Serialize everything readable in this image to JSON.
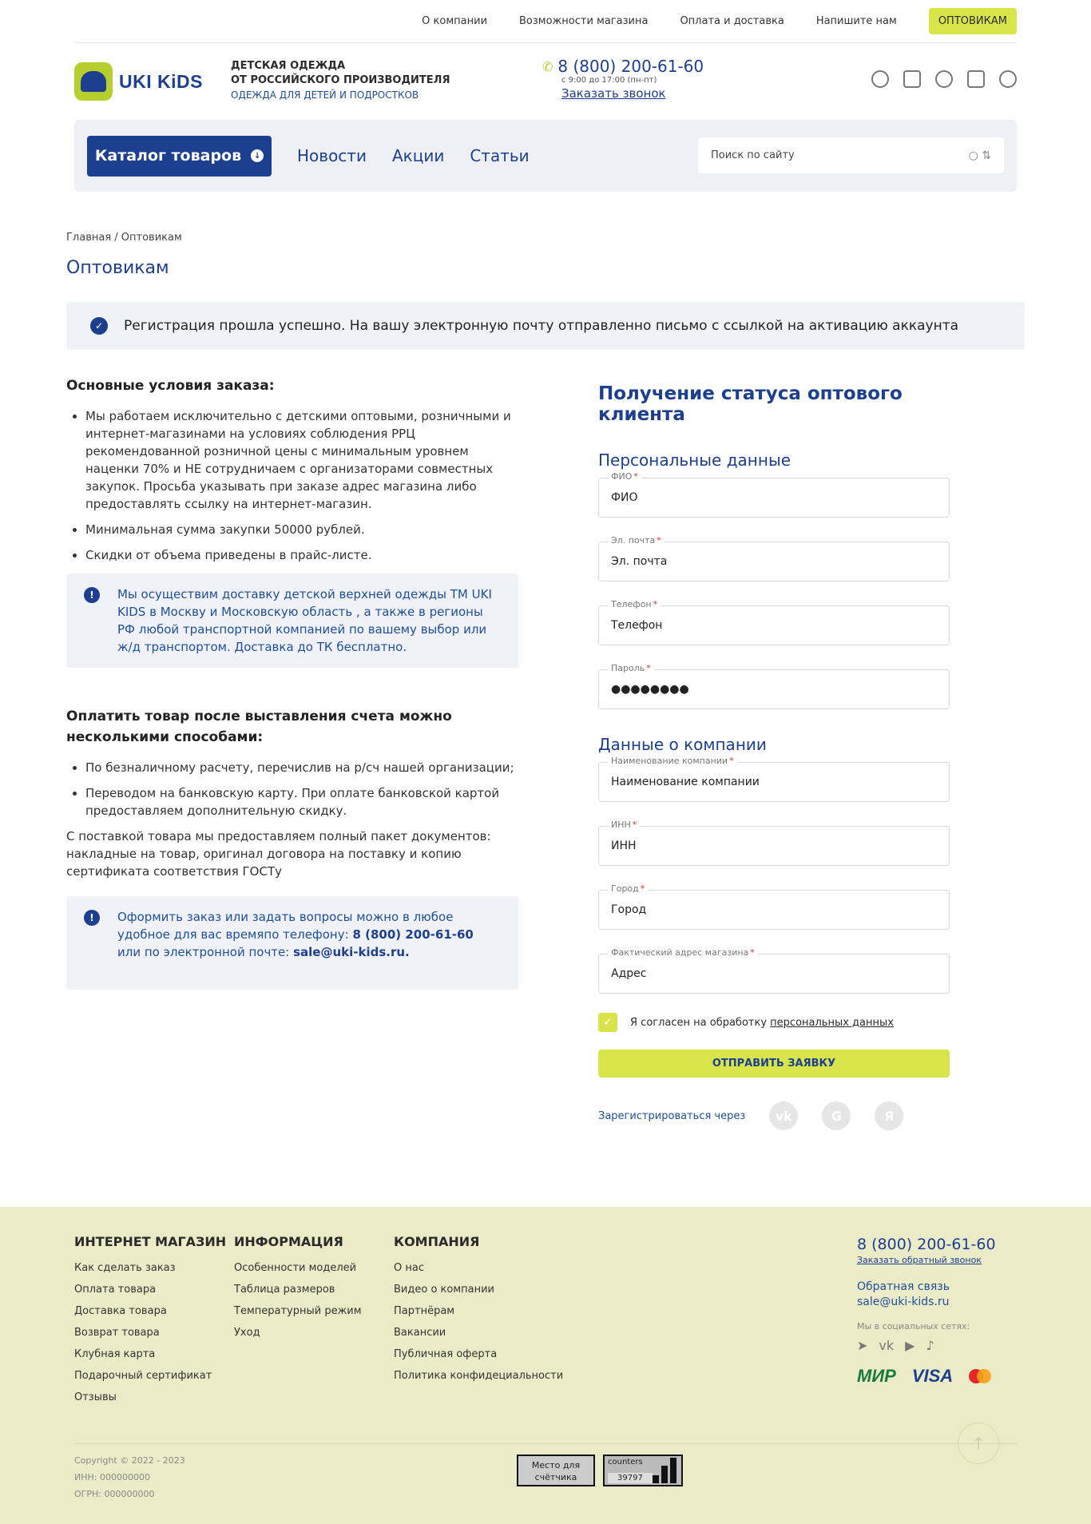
{
  "topnav": [
    "О компании",
    "Возможности магазина",
    "Оплата и доставка",
    "Напишите нам",
    "ОПТОВИКАМ"
  ],
  "logo": "UKI KiDS",
  "tagline": {
    "line1": "ДЕТСКАЯ ОДЕЖДА",
    "line2": "ОТ РОССИЙСКОГО ПРОИЗВОДИТЕЛЯ",
    "line3": "ОДЕЖДА ДЛЯ ДЕТЕЙ И ПОДРОСТКОВ"
  },
  "phone": {
    "number": "8 (800) 200-61-60",
    "hours": "с 9:00 до 17:00 (пн-пт)",
    "callback": "Заказать звонок"
  },
  "header_icons": [
    "location-icon",
    "delivery-icon",
    "heart-icon",
    "basket-icon",
    "user-icon"
  ],
  "nav": {
    "catalog": "Каталог товаров",
    "links": [
      "Новости",
      "Акции",
      "Статьи"
    ],
    "search_placeholder": "Поиск по сайту"
  },
  "breadcrumb": "Главная / Оптовикам",
  "title": "Оптовикам",
  "success": "Регистрация прошла успешно. На вашу электронную почту отправленно письмо с ссылкой на активацию аккаунта",
  "left": {
    "conditions_title": "Основные условия заказа:",
    "conditions": [
      "Мы работаем исключительно с детскими оптовыми, розничными и интернет-магазинами на условиях соблюдения РРЦ рекомендованной розничной цены с минимальным уровнем наценки 70% и НЕ сотрудничаем с организаторами совместных закупок. Просьба указывать при заказе адрес магазина либо предоставлять ссылку на интернет-магазин.",
      "Минимальная сумма закупки 50000 рублей.",
      "Скидки от объема приведены в прайс-листе."
    ],
    "delivery_note": "Мы осуществим доставку детской верхней одежды ТМ UKI KIDS в Москву и Московскую область , а также в регионы РФ любой транспортной компанией по вашему выбор или ж/д транспортом. Доставка до ТК бесплатно.",
    "payment_title": "Оплатить товар после выставления счета можно несколькими способами:",
    "payment": [
      "По безналичному расчету, перечислив на р/сч нашей организации;",
      "Переводом на банковскую карту. При оплате банковской картой предоставляем дополнительную скидку."
    ],
    "documents": "С поставкой товара мы предоставляем полный пакет документов: накладные на товар, оригинал договора на поставку и копию сертификата соответствия ГОСТу",
    "contact_note": {
      "pre": "Оформить заказ или задать вопросы можно в любое удобное для вас времяпо телефону:",
      "phone": "8 (800) 200-61-60",
      "mid": "или по электронной почте:",
      "email": "sale@uki-kids.ru."
    }
  },
  "form": {
    "title": "Получение статуса оптового клиента",
    "personal_title": "Персональные данные",
    "company_title": "Данные о компании",
    "fields_personal": [
      {
        "label": "ФИО",
        "placeholder": "ФИО"
      },
      {
        "label": "Эл. почта",
        "placeholder": "Эл. почта"
      },
      {
        "label": "Телефон",
        "placeholder": "Телефон"
      },
      {
        "label": "Пароль",
        "value": "●●●●●●●●"
      }
    ],
    "fields_company": [
      {
        "label": "Наименование компании",
        "placeholder": "Наименование компании"
      },
      {
        "label": "ИНН",
        "placeholder": "ИНН"
      },
      {
        "label": "Город",
        "placeholder": "Город"
      },
      {
        "label": "Фактический адрес магазина",
        "placeholder": "Адрес"
      }
    ],
    "agree_text": "Я согласен на обработку",
    "agree_link": "персональных данных",
    "submit": "ОТПРАВИТЬ ЗАЯВКУ",
    "register_via": "Зарегистрироваться через",
    "social": [
      "vk-icon",
      "google-icon",
      "yandex-icon"
    ]
  },
  "footer": {
    "col1": {
      "title": "ИНТЕРНЕТ МАГАЗИН",
      "items": [
        "Как сделать заказ",
        "Оплата товара",
        "Доставка товара",
        "Возврат товара",
        "Клубная карта",
        "Подарочный сертификат",
        "Отзывы"
      ]
    },
    "col2": {
      "title": "ИНФОРМАЦИЯ",
      "items": [
        "Особенности моделей",
        "Таблица размеров",
        "Температурный режим",
        "Уход"
      ]
    },
    "col3": {
      "title": "КОМПАНИЯ",
      "items": [
        "О нас",
        "Видео о компании",
        "Партнёрам",
        "Вакансии",
        "Публичная оферта",
        "Политика конфидециальности"
      ]
    },
    "phone": "8 (800) 200-61-60",
    "callback": "Заказать обратный звонок",
    "feedback": "Обратная связь",
    "email": "sale@uki-kids.ru",
    "socials_label": "Мы в социальных сетях:",
    "social_icons": [
      "telegram-icon",
      "vk-icon",
      "youtube-icon",
      "tiktok-icon"
    ],
    "pay": {
      "mir": "МИР",
      "visa": "VISA"
    },
    "copyright": "Copyright © 2022 - 2023",
    "inn": "ИНН: 000000000",
    "ogrn": "ОГРН: 000000000",
    "counter1": "Место для счётчика",
    "counter2_label": "counters",
    "counter2_value": "39797"
  }
}
